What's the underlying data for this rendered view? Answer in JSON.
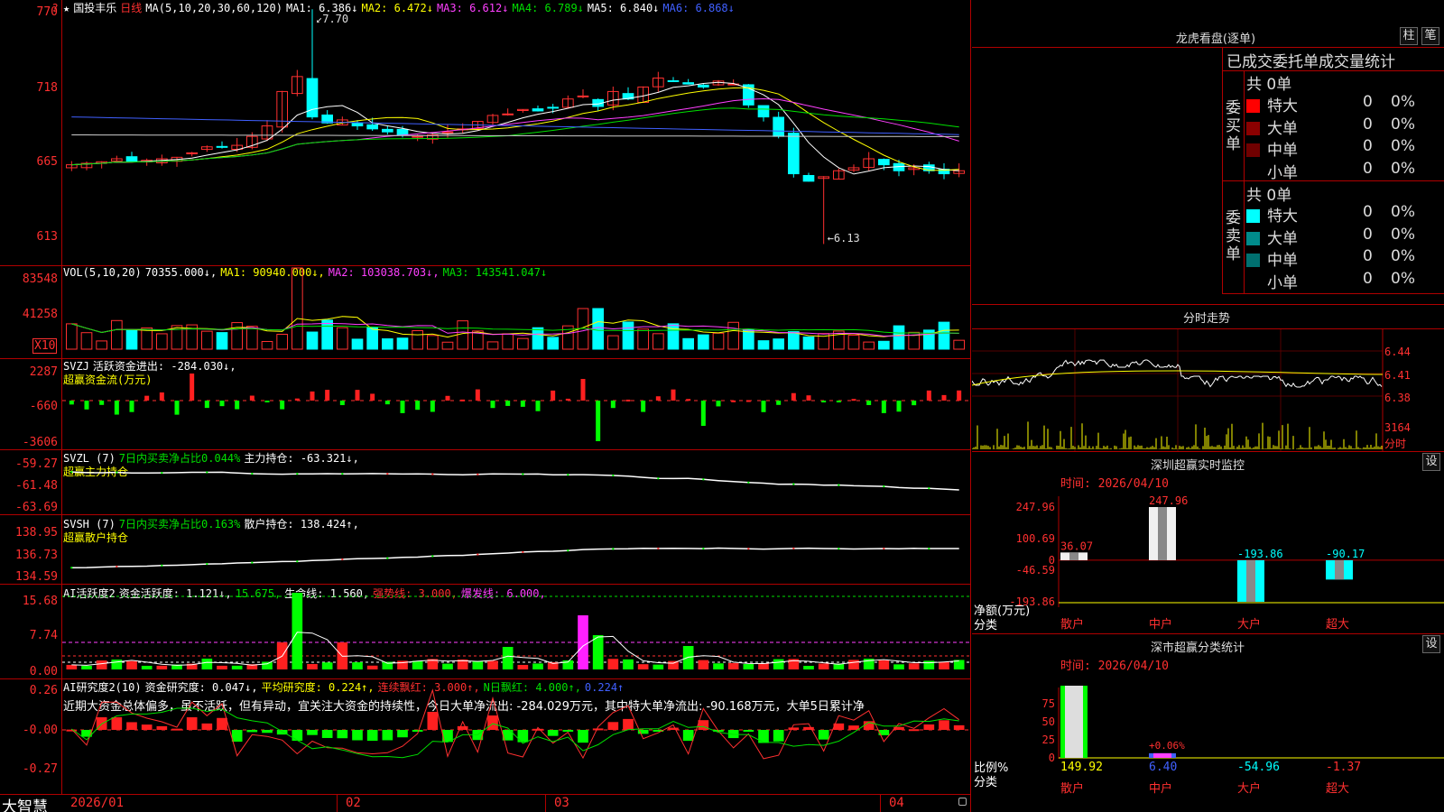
{
  "stock": {
    "name": "国投丰乐",
    "period": "日线",
    "ma_label": "MA(5,10,20,30,60,120)"
  },
  "main": {
    "ma1": "MA1: 6.386↓",
    "ma2": "MA2: 6.472↓",
    "ma3": "MA3: 6.612↓",
    "ma4": "MA4: 6.789↓",
    "ma5": "MA5: 6.840↓",
    "ma6": "MA6: 6.868↓",
    "y_ticks": [
      "7.70",
      "7.18",
      "6.65",
      "6.13"
    ],
    "y_ticks_shown": [
      "770",
      "718",
      "665",
      "613"
    ],
    "high_label": "7.70",
    "low_label": "6.13"
  },
  "vol": {
    "label": "VOL(5,10,20)",
    "val": "70355.000↓,",
    "ma1": "MA1: 90940.000↓,",
    "ma2": "MA2: 103038.703↓,",
    "ma3": "MA3: 143541.047↓",
    "y_ticks": [
      "83548",
      "41258"
    ],
    "unit": "X10"
  },
  "svzj": {
    "label": "SVZJ",
    "text1": "活跃资金进出: -284.030↓,",
    "text2": "超赢资金流(万元)",
    "y_ticks": [
      "2287",
      "-660",
      "-3606"
    ]
  },
  "svzl": {
    "label": "SVZL (7)",
    "text1": "7日内买卖净占比0.044%",
    "text2": "主力持仓: -63.321↓,",
    "text3": "超赢主力持仓",
    "y_ticks": [
      "-59.27",
      "-61.48",
      "-63.69"
    ]
  },
  "svsh": {
    "label": "SVSH (7)",
    "text1": "7日内买卖净占比0.163%",
    "text2": "散户持仓: 138.424↑,",
    "text3": "超赢散户持仓",
    "y_ticks": [
      "138.95",
      "136.73",
      "134.59"
    ]
  },
  "ai_active": {
    "label": "AI活跃度2",
    "t1": "资金活跃度: 1.121↓,",
    "t2": "15.675,",
    "t3": "生命线: 1.560,",
    "t4": "强势线: 3.000,",
    "t5": "爆发线: 6.000,",
    "y_ticks": [
      "15.68",
      "7.74",
      "0.00"
    ]
  },
  "ai_research": {
    "label": "AI研究度2(10)",
    "t1": "资金研究度: 0.047↓,",
    "t2": "平均研究度: 0.224↑,",
    "t3": "连续飘红: 3.000↑,",
    "t4": "N日飘红: 4.000↑,",
    "t5": "0.224↑",
    "desc": "近期大资金总体偏多，虽不活跃，但有异动，宜关注大资金的持续性，今日大单净流出: -284.029万元，其中特大单净流出: -90.168万元，大单5日累计净",
    "y_ticks": [
      "0.26",
      "-0.00",
      "-0.27"
    ]
  },
  "x_axis": {
    "labels": [
      "2026/01",
      "02",
      "03",
      "04"
    ]
  },
  "brand": "大智慧",
  "right": {
    "lhb_title": "龙虎看盘(逐单)",
    "btn1": "柱",
    "btn2": "笔",
    "order_title": "已成交委托单成交量统计",
    "buy_group": "委买单",
    "sell_group": "委卖单",
    "buy_total": "共 0单",
    "sell_total": "共 0单",
    "buy_rows": [
      {
        "label": "特大",
        "count": "0",
        "pct": "0%",
        "color": "#ff0000"
      },
      {
        "label": "大单",
        "count": "0",
        "pct": "0%",
        "color": "#8b0000"
      },
      {
        "label": "中单",
        "count": "0",
        "pct": "0%",
        "color": "#700000"
      },
      {
        "label": "小单",
        "count": "0",
        "pct": "0%",
        "color": "#000000"
      }
    ],
    "sell_rows": [
      {
        "label": "特大",
        "count": "0",
        "pct": "0%",
        "color": "#00ffff"
      },
      {
        "label": "大单",
        "count": "0",
        "pct": "0%",
        "color": "#008b8b"
      },
      {
        "label": "中单",
        "count": "0",
        "pct": "0%",
        "color": "#007070"
      },
      {
        "label": "小单",
        "count": "0",
        "pct": "0%",
        "color": "#000000"
      }
    ],
    "intraday_title": "分时走势",
    "intraday_ticks": [
      "6.44",
      "6.41",
      "6.38",
      "3164",
      "分时"
    ],
    "sz_monitor_title": "深圳超赢实时监控",
    "sz_monitor_btn": "设",
    "sz_monitor_time": "时间: 2026/04/10",
    "sz_monitor_yticks": [
      "247.96",
      "100.69",
      "0",
      "-46.59",
      "-193.86"
    ],
    "sz_monitor_ylabel1": "净额(万元)",
    "sz_monitor_ylabel2": "分类",
    "sz_monitor_cats": [
      "散户",
      "中户",
      "大户",
      "超大"
    ],
    "sz_monitor_vals": [
      "36.07",
      "247.96",
      "-193.86",
      "-90.17"
    ],
    "sz_class_title": "深市超赢分类统计",
    "sz_class_btn": "设",
    "sz_class_time": "时间: 2026/04/10",
    "sz_class_yticks": [
      "75",
      "50",
      "25",
      "0"
    ],
    "sz_class_ylabel1": "比例%",
    "sz_class_ylabel2": "分类",
    "sz_class_cats": [
      "散户",
      "中户",
      "大户",
      "超大"
    ],
    "sz_class_vals": [
      "149.92",
      "6.40",
      "-54.96",
      "-1.37"
    ],
    "sz_class_inline": "+0.06%"
  }
}
